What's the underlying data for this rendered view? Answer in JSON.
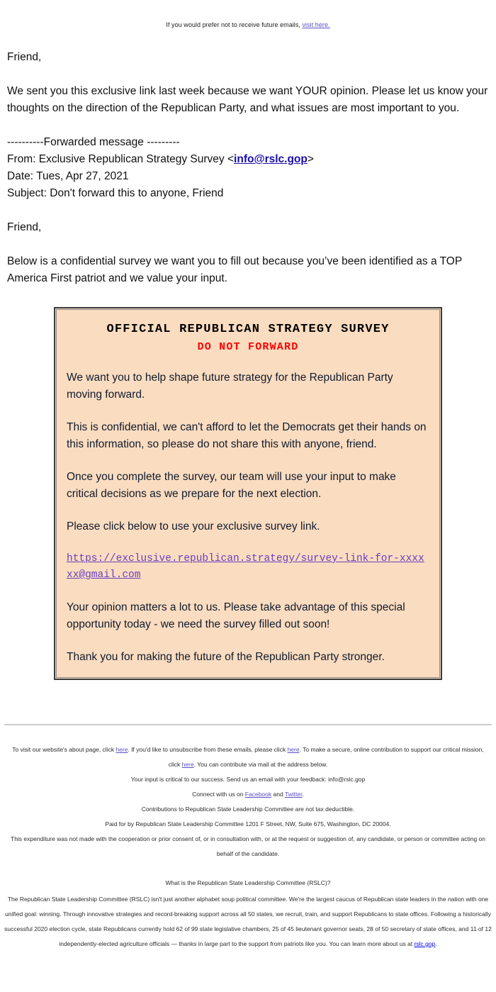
{
  "preheader": {
    "text": "If you would prefer not to receive future emails, ",
    "link_label": "visit here."
  },
  "email": {
    "greeting_1": "Friend,",
    "intro_paragraph": "We sent you this exclusive link last week because we want YOUR opinion. Please let us know your thoughts on the direction of the Republican Party, and what issues are most important to you.",
    "forward_divider": "----------Forwarded message ---------",
    "from_prefix": "From: Exclusive Republican Strategy Survey <",
    "from_email": "info@rslc.gop",
    "from_suffix": ">",
    "date_line": "Date: Tues, Apr 27, 2021",
    "subject_line": "Subject: Don't forward this to anyone, Friend",
    "greeting_2": "Friend,",
    "below_paragraph": "Below is a confidential survey we want you to fill out because you’ve been identified as a TOP America First patriot and we value your input."
  },
  "survey": {
    "title": "OFFICIAL REPUBLICAN STRATEGY SURVEY",
    "subtitle": "DO NOT FORWARD",
    "paragraph_1": "We want you to help shape future strategy for the Republican Party moving forward.",
    "paragraph_2": "This is confidential, we can't afford to let the Democrats get their hands on this information, so please do not share this with anyone, friend.",
    "paragraph_3": "Once you complete the survey, our team will use your input to make critical decisions as we prepare for the next election.",
    "paragraph_4": "Please click below to use your exclusive survey link.",
    "link_text": "https://exclusive.republican.strategy/survey-link-for-xxxxxx@gmail.com",
    "paragraph_5": "Your opinion matters a lot to us. Please take advantage of this special opportunity today - we need the survey filled out soon!",
    "paragraph_6": "Thank you for making the future of the Republican Party stronger.",
    "background_color": "#fadcc0",
    "border_color": "#3a3a3a",
    "title_color": "#000000",
    "subtitle_color": "#ff0000",
    "link_color": "#6a3fc0"
  },
  "footer": {
    "line1_part1": "To visit our website's about page, click ",
    "line1_link1": "here",
    "line1_part2": ". If you'd like to unsubscribe from these emails, please click ",
    "line1_link2": "here",
    "line1_part3": ". To make a secure, online contribution to support our critical mission, click ",
    "line1_link3": "here",
    "line1_part4": ". You can contribute via mail at the address below.",
    "feedback_line": "Your input is critical to our success. Send us an email with your feedback: info@rslc.gop",
    "connect_prefix": "Connect with us on ",
    "connect_facebook": "Facebook",
    "connect_joiner": " and ",
    "connect_twitter": "Twitter",
    "connect_suffix": ".",
    "tax_line": "Contributions to Republican State Leadership Committee are not tax deductible.",
    "paid_for_line": "Paid for by Republican State Leadership Committee 1201 F Street, NW, Suite 675, Washington, DC 20004.",
    "expenditure_line": "This expenditure was not made with the cooperation or prior consent of, or in consultation with, or at the request or suggestion of, any candidate, or person or committee acting on behalf of the candidate."
  },
  "about": {
    "question": "What is the Republican State Leadership Committee (RSLC)?",
    "body_part1": "The Republican State Leadership Committee (RSLC) isn't just another alphabet soup political committee. We're the largest caucus of Republican state leaders in the nation with one unified goal: winning. Through innovative strategies and record-breaking support across all 50 states, we recruit, train, and support Republicans to state offices. Following a historically successful 2020 election cycle, state Republicans currently hold 62 of 99 state legislative chambers, 25 of 45 lieutenant governor seats, 28 of 50 secretary of state offices, and 11 of 12 independently-elected agriculture officials — thanks in large part to the support from patriots like you. You can learn more about us at ",
    "body_link": "rslc.gop",
    "body_part2": "."
  }
}
